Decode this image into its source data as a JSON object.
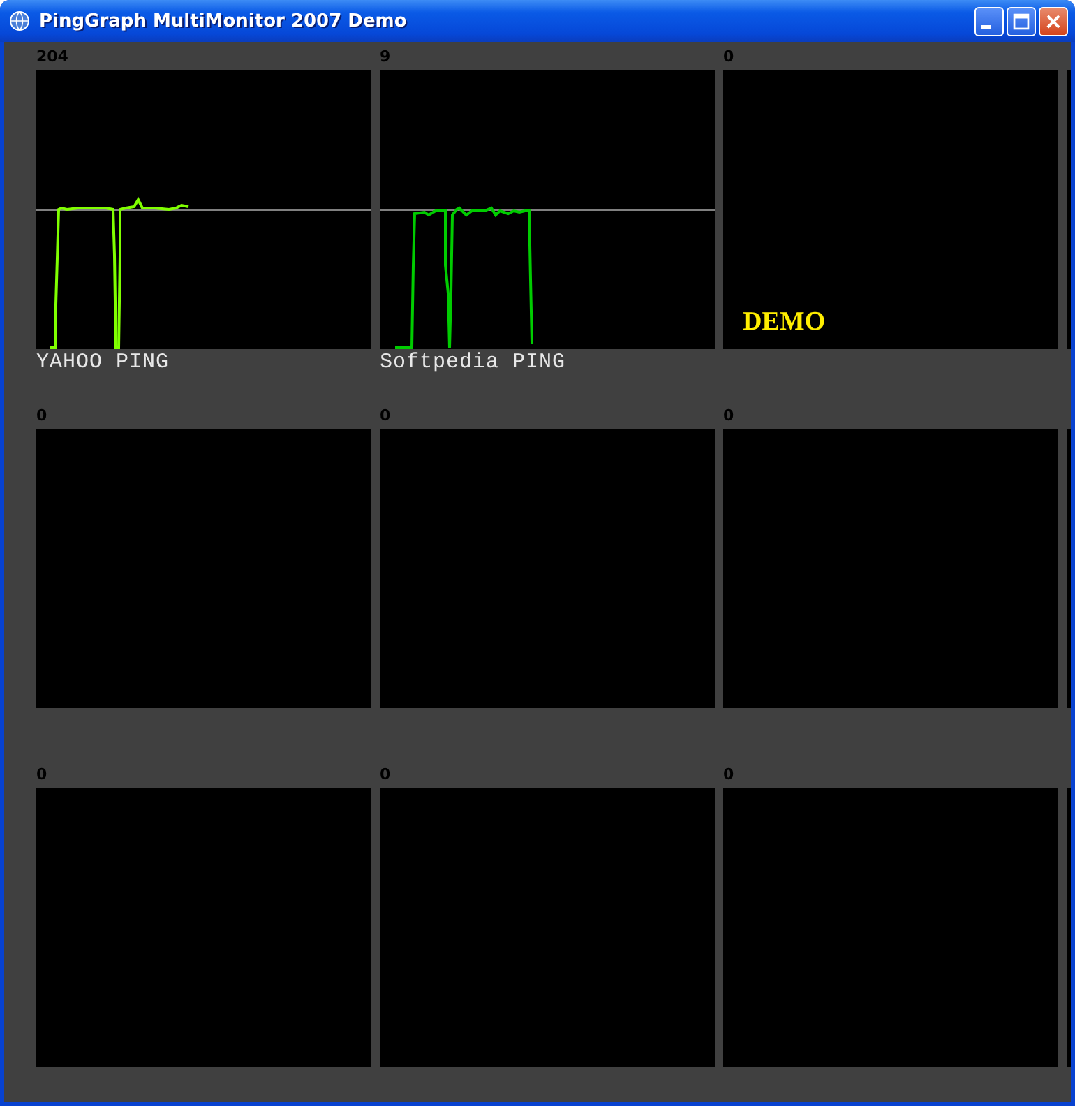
{
  "window": {
    "title": "PingGraph MultiMonitor 2007 Demo"
  },
  "monitors": [
    {
      "value": "204",
      "kind": "trace",
      "color": "#80ff00",
      "name": "YAHOO PING"
    },
    {
      "value": "9",
      "kind": "trace",
      "color": "#00cc00",
      "name": "Softpedia PING"
    },
    {
      "value": "0",
      "kind": "demo",
      "overlay": "DEMO"
    },
    {
      "value": "0",
      "kind": "empty"
    },
    {
      "value": "0",
      "kind": "empty"
    },
    {
      "value": "0",
      "kind": "empty"
    },
    {
      "value": "0",
      "kind": "empty"
    },
    {
      "value": "0",
      "kind": "empty"
    },
    {
      "value": "0",
      "kind": "empty"
    }
  ]
}
